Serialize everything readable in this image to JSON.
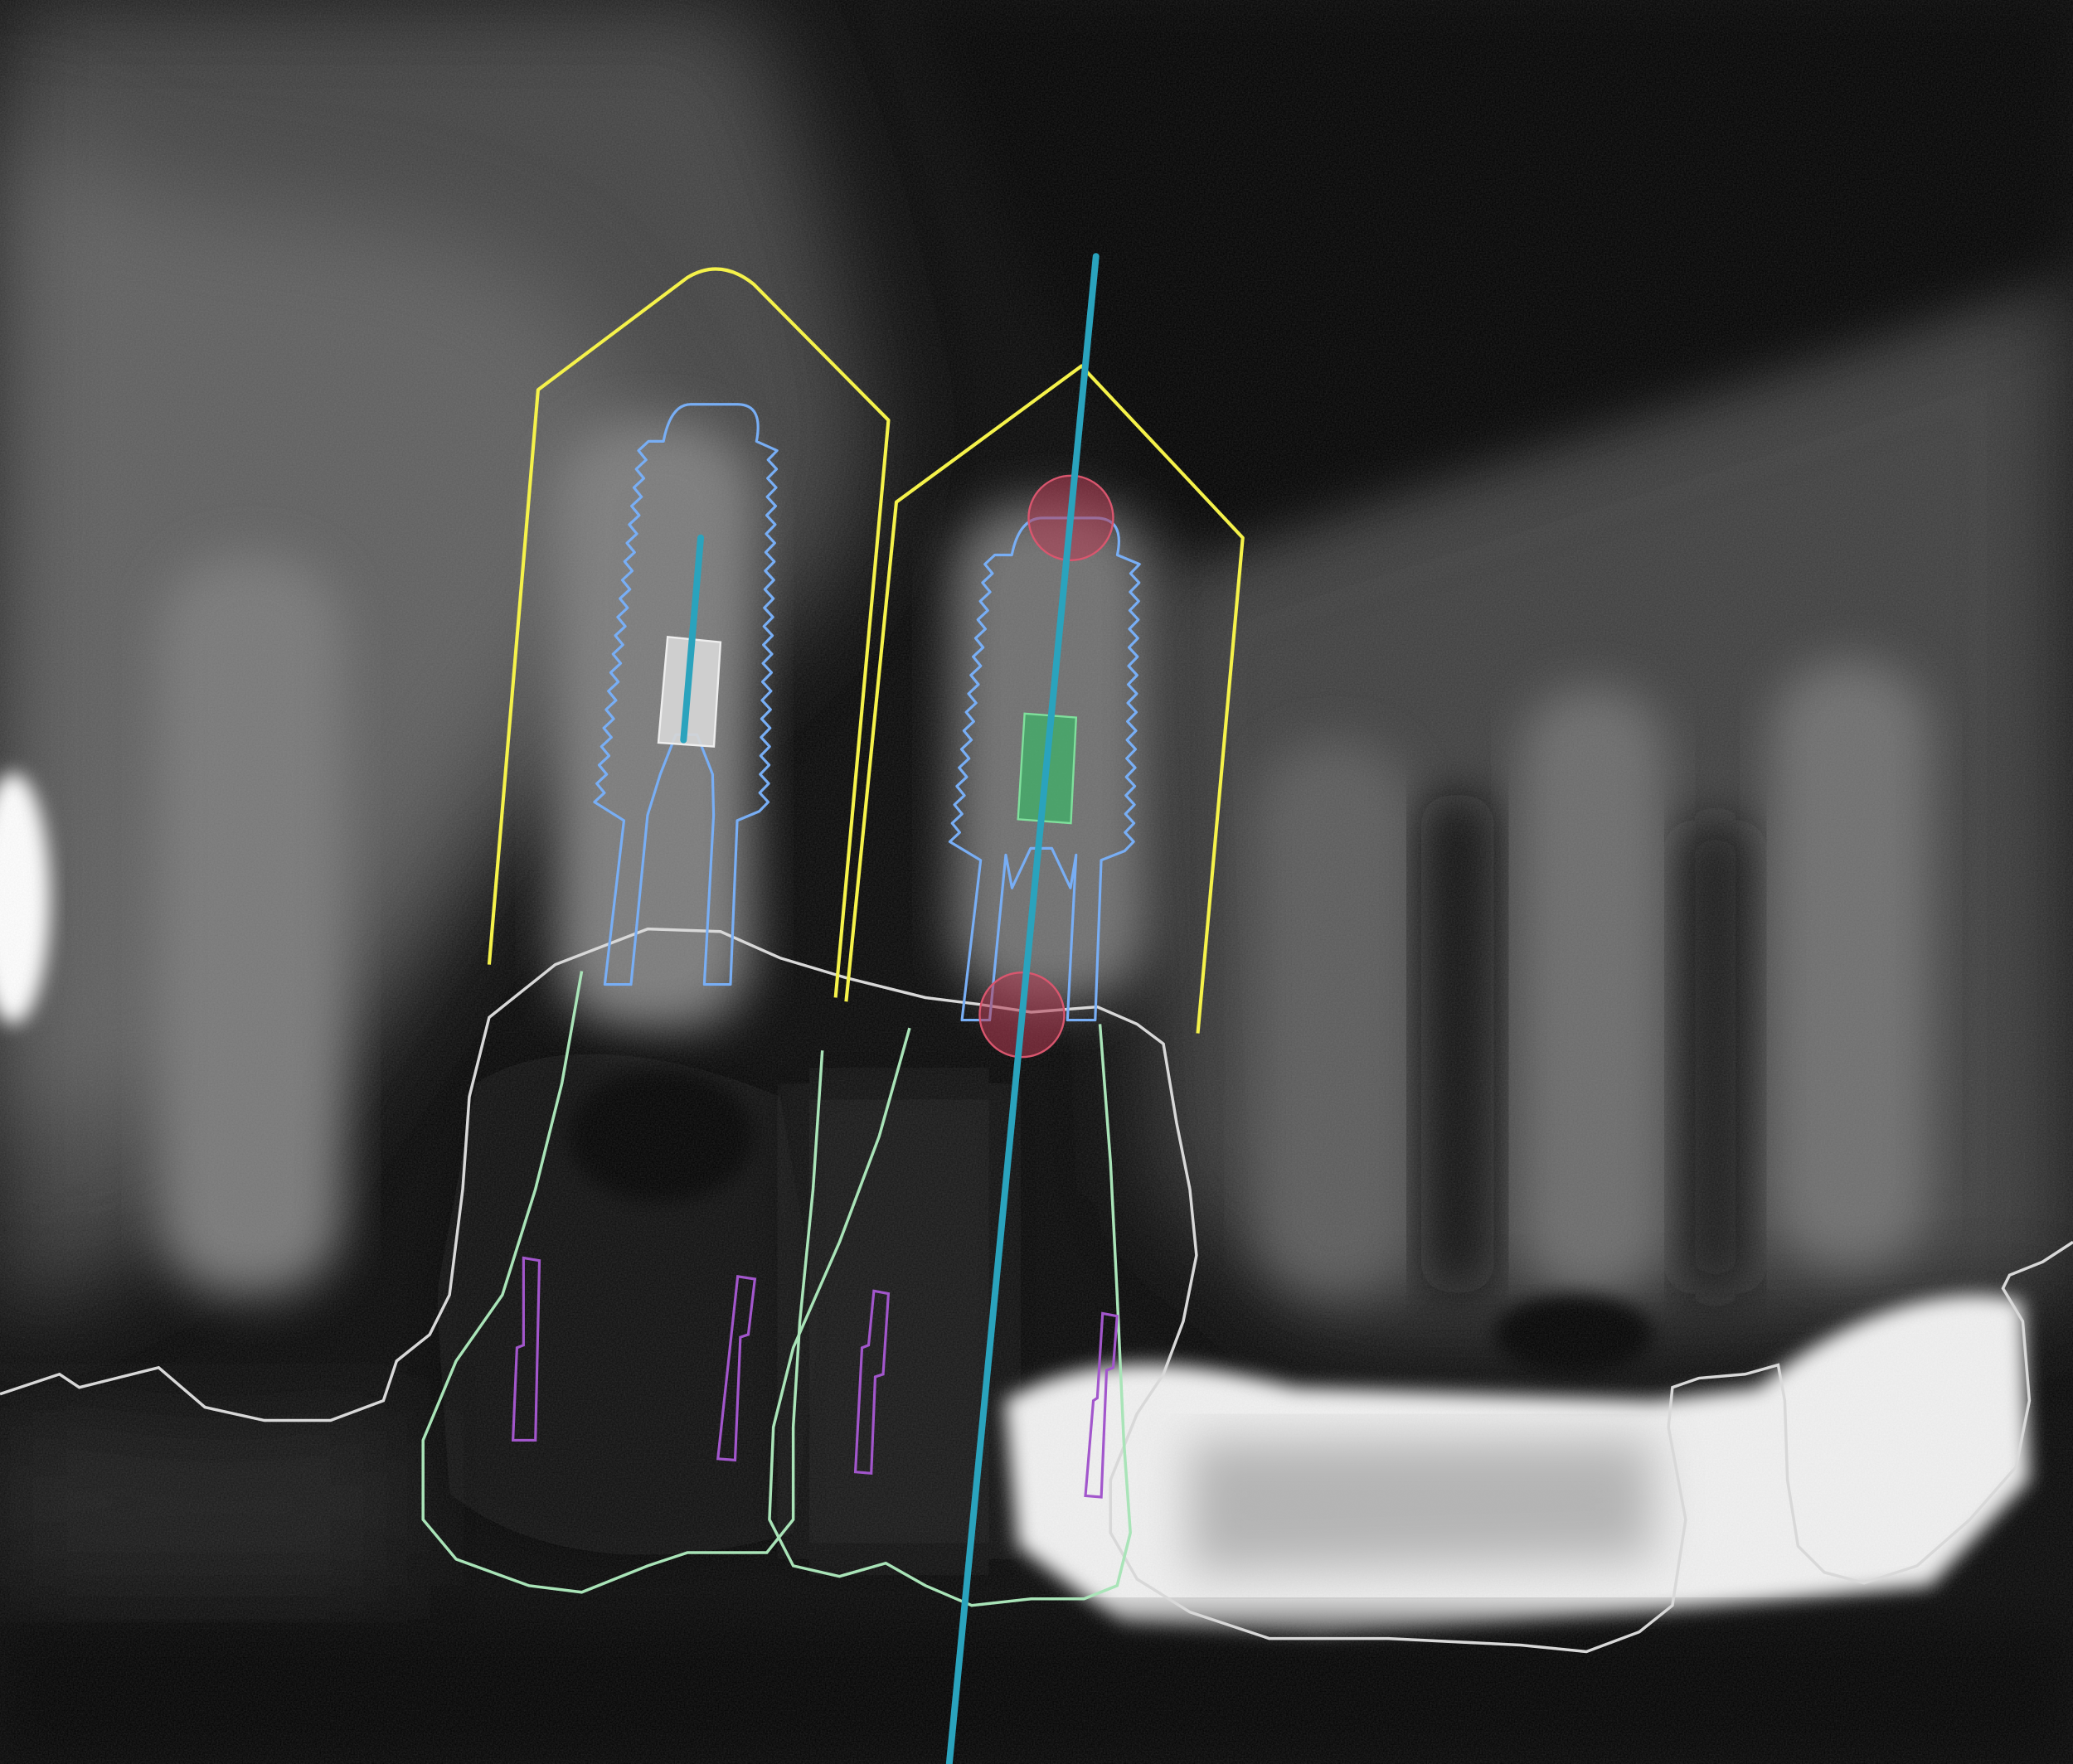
{
  "view": {
    "type": "dental-cbct-cross-section",
    "annotation_colors": {
      "safety_zone": "#f5f24a",
      "implant_outline": "#78aef5",
      "implant_axis": "#2aa3bd",
      "tooth_outline": "#d8d8d8",
      "crown_outline": "#a9e4b8",
      "nerve_marker": "#b53a52",
      "active_abutment": "#3fb168",
      "inactive_abutment": "#d6d6d6",
      "guide_sleeve": "#a256cc"
    }
  },
  "implants": [
    {
      "id": "implant-left",
      "selected": false
    },
    {
      "id": "implant-right",
      "selected": true
    }
  ],
  "collision_markers": 2,
  "guide_sleeves": 4
}
